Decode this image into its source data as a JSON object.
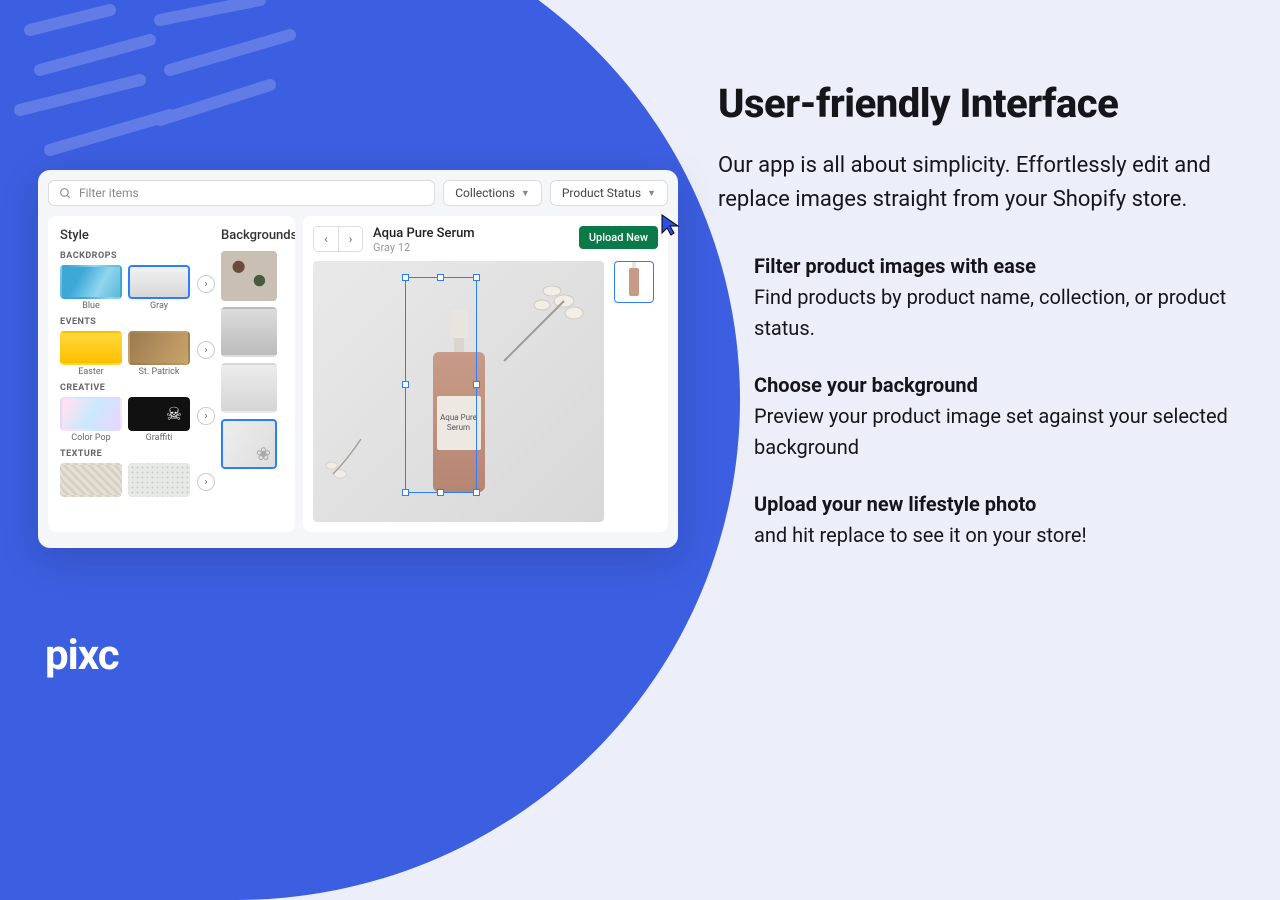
{
  "brand": {
    "logo": "pixc"
  },
  "marketing": {
    "title": "User-friendly Interface",
    "lead": "Our app is all about simplicity. Effortlessly edit and replace images straight from your Shopify store.",
    "features": [
      {
        "heading": "Filter product images with ease",
        "body": "Find products by product name, collection, or product status."
      },
      {
        "heading": "Choose your background",
        "body": "Preview your product image set against your selected background"
      },
      {
        "heading": "Upload your new lifestyle photo",
        "body": "and hit replace to see it on your store!"
      }
    ]
  },
  "toolbar": {
    "search_placeholder": "Filter items",
    "collections_label": "Collections",
    "status_label": "Product Status"
  },
  "style_panel": {
    "title": "Style",
    "backgrounds_title": "Backgrounds",
    "categories": {
      "backdrops": {
        "label": "BACKDROPS",
        "items": [
          "Blue",
          "Gray"
        ]
      },
      "events": {
        "label": "EVENTS",
        "items": [
          "Easter",
          "St. Patrick"
        ]
      },
      "creative": {
        "label": "CREATIVE",
        "items": [
          "Color Pop",
          "Graffiti"
        ]
      },
      "texture": {
        "label": "TEXTURE",
        "items": [
          "",
          ""
        ]
      }
    },
    "selected_style": "Gray",
    "selected_background_index": 3
  },
  "product": {
    "name": "Aqua Pure Serum",
    "variant": "Gray 12",
    "upload_label": "Upload New",
    "label_text": "Aqua Pure Serum"
  }
}
